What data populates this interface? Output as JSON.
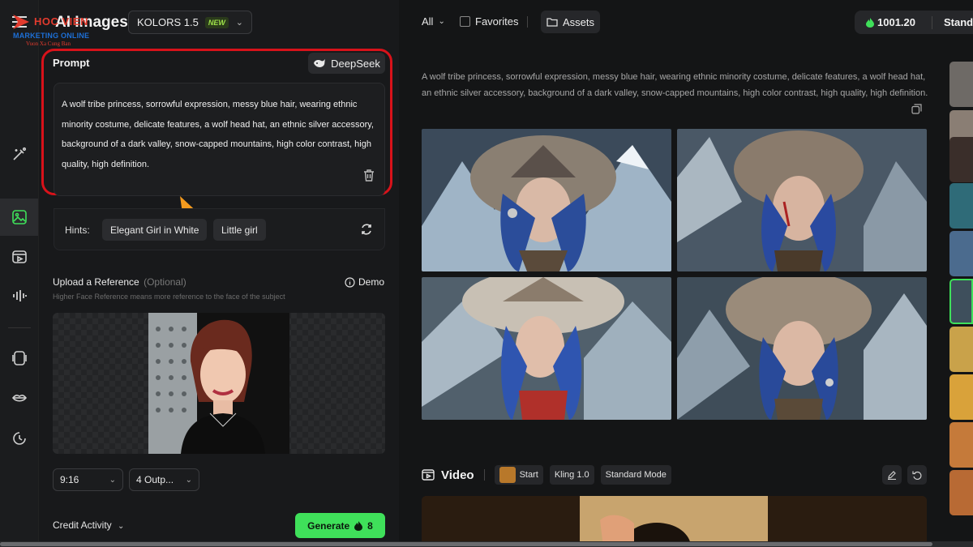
{
  "logo": {
    "brand_line1": "HOC VIEN",
    "brand_line2": "MARKETING ONLINE",
    "brand_line3": "Vuon Xa Cung Ban"
  },
  "header": {
    "title": "AI Images",
    "model": "KOLORS 1.5",
    "model_badge": "NEW"
  },
  "prompt": {
    "label": "Prompt",
    "deepseek_label": "DeepSeek",
    "text": "A wolf tribe princess, sorrowful expression, messy blue hair, wearing ethnic minority costume, delicate features, a wolf head hat, an ethnic silver accessory, background of a dark valley, snow-capped mountains, high color contrast, high quality, high definition."
  },
  "hints": {
    "label": "Hints:",
    "items": [
      "Elegant Girl in White",
      "Little girl"
    ]
  },
  "reference": {
    "title": "Upload a Reference",
    "optional": "(Optional)",
    "subtitle": "Higher Face Reference means more reference to the face of the subject",
    "demo_label": "Demo"
  },
  "options": {
    "aspect_ratio": "9:16",
    "outputs": "4 Outp..."
  },
  "footer": {
    "credit_activity": "Credit Activity",
    "generate_label": "Generate",
    "generate_cost": "8"
  },
  "topbar": {
    "filter": "All",
    "favorites": "Favorites",
    "assets": "Assets",
    "credits": "1001.20",
    "plan": "Standa"
  },
  "result": {
    "prompt_echo": "A wolf tribe princess, sorrowful expression, messy blue hair, wearing ethnic minority costume, delicate features, a wolf head hat, an ethnic silver accessory, background of a dark valley, snow-capped mountains, high color contrast, high quality, high definition."
  },
  "video": {
    "title": "Video",
    "start_label": "Start",
    "model": "Kling 1.0",
    "mode": "Standard Mode"
  },
  "colors": {
    "accent_green": "#3fe05a",
    "highlight_red": "#d8121a",
    "background": "#141516"
  }
}
